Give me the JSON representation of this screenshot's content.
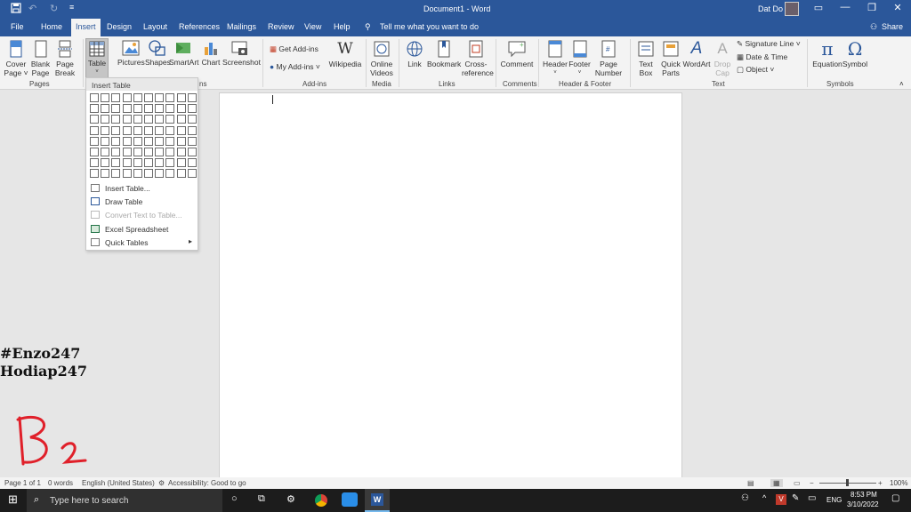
{
  "titlebar": {
    "title": "Document1 - Word",
    "user": "Dat Do",
    "customize_glyph": "≡"
  },
  "tabs": [
    {
      "label": "File"
    },
    {
      "label": "Home"
    },
    {
      "label": "Insert"
    },
    {
      "label": "Design"
    },
    {
      "label": "Layout"
    },
    {
      "label": "References"
    },
    {
      "label": "Mailings"
    },
    {
      "label": "Review"
    },
    {
      "label": "View"
    },
    {
      "label": "Help"
    }
  ],
  "tellme": "Tell me what you want to do",
  "share": "Share",
  "ribbon": {
    "cover_page": "Cover\nPage ˅",
    "blank_page": "Blank\nPage",
    "page_break": "Page\nBreak",
    "table": "Table",
    "pictures": "Pictures",
    "shapes": "Shapes",
    "smartart": "SmartArt",
    "chart": "Chart",
    "screenshot": "Screenshot",
    "get_addins": "Get Add-ins",
    "my_addins": "My Add-ins",
    "wikipedia": "Wikipedia",
    "online_videos": "Online\nVideos",
    "link": "Link",
    "bookmark": "Bookmark",
    "cross_reference": "Cross-\nreference",
    "comment": "Comment",
    "header": "Header",
    "footer": "Footer",
    "page_number": "Page\nNumber",
    "text_box": "Text\nBox",
    "quick_parts": "Quick\nParts",
    "wordart": "WordArt",
    "drop_cap": "Drop\nCap",
    "signature_line": "Signature Line",
    "date_time": "Date & Time",
    "object": "Object",
    "equation": "Equation",
    "symbol": "Symbol",
    "groups": {
      "pages": "Pages",
      "tables_partial": "ns",
      "addins": "Add-ins",
      "media": "Media",
      "links": "Links",
      "comments": "Comments",
      "header_footer": "Header & Footer",
      "text": "Text",
      "symbols": "Symbols"
    }
  },
  "dropdown": {
    "title": "Insert Table",
    "items": [
      {
        "label": "Insert Table...",
        "disabled": false
      },
      {
        "label": "Draw Table",
        "disabled": false
      },
      {
        "label": "Convert Text to Table...",
        "disabled": true
      },
      {
        "label": "Excel Spreadsheet",
        "disabled": false
      },
      {
        "label": "Quick Tables",
        "disabled": false
      }
    ]
  },
  "document": {
    "line1": "#Enzo247",
    "line2": "Hodiap247"
  },
  "status": {
    "page": "Page 1 of 1",
    "words": "0 words",
    "language": "English (United States)",
    "accessibility": "Accessibility: Good to go",
    "zoom": "100%"
  },
  "taskbar": {
    "search_placeholder": "Type here to search",
    "language": "ENG",
    "time": "8:53 PM",
    "date": "3/10/2022"
  },
  "colors": {
    "word_blue": "#2b579a",
    "ribbon_bg": "#f3f3f3",
    "handwriting": "#e0202a"
  }
}
